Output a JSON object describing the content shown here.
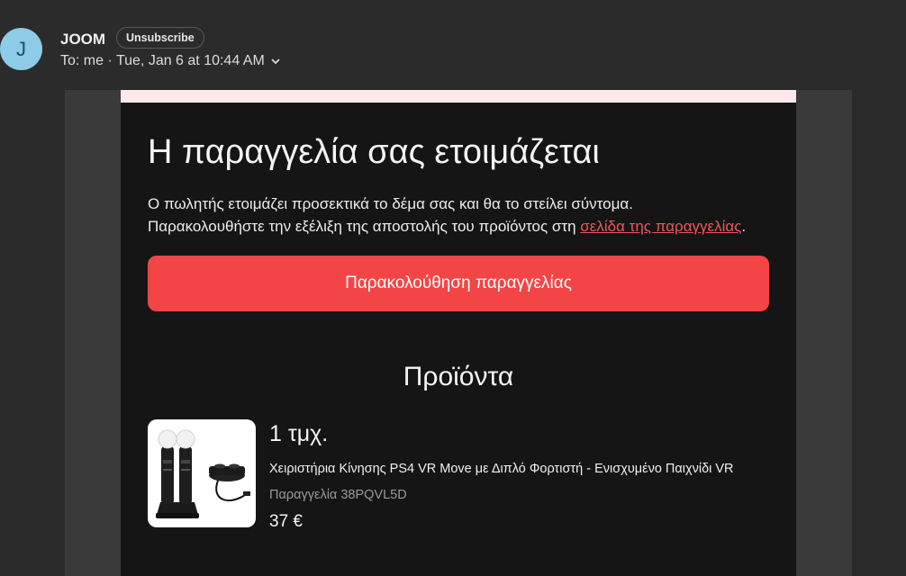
{
  "header": {
    "avatar_letter": "J",
    "sender": "JOOM",
    "unsubscribe_label": "Unsubscribe",
    "to_line": "To:  me · Tue, Jan 6 at 10:44 AM"
  },
  "email": {
    "title": "Η παραγγελία σας ετοιμάζεται",
    "desc_line1": "Ο πωλητής ετοιμάζει προσεκτικά το δέμα σας και θα το στείλει σύντομα.",
    "desc_line2_prefix": "Παρακολουθήστε την εξέλιξη της αποστολής του προϊόντος στη ",
    "desc_link": "σελίδα της παραγγελίας",
    "desc_line2_suffix": ".",
    "cta_label": "Παρακολούθηση παραγγελίας",
    "section_title": "Προϊόντα",
    "product": {
      "quantity": "1 τμχ.",
      "name": "Χειριστήρια Κίνησης PS4 VR Move με Διπλό Φορτιστή - Ενισχυμένο Παιχνίδι VR",
      "order": "Παραγγελία 38PQVL5D",
      "price": "37 €",
      "image_icon": "vr-controllers-with-charger"
    }
  },
  "colors": {
    "accent": "#f34545",
    "link": "#f2545b",
    "card_bg": "#151515",
    "page_bg": "#2b2b2b",
    "stripe": "#fde8ec"
  }
}
